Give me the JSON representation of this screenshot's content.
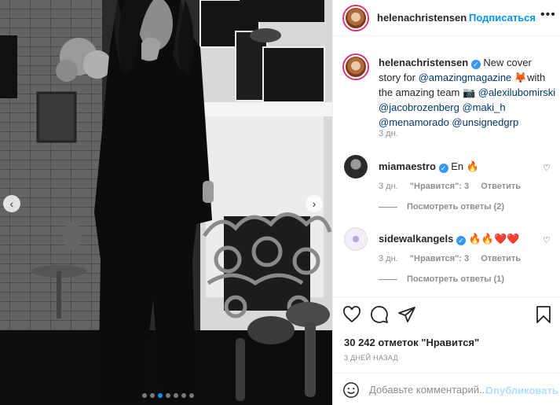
{
  "post": {
    "photo_alt": "",
    "carousel": {
      "count": 7,
      "active_index": 2
    }
  },
  "header": {
    "username": "helenachristensen",
    "follow_label": "Подписаться",
    "more_label": "•••"
  },
  "caption": {
    "username": "helenachristensen",
    "verified_mark": "✓",
    "text_1": " New cover story for ",
    "mention_1": "@amazingmagazine",
    "text_2": " 🦊with the amazing team 📷 ",
    "mention_2": "@alexilubomirski",
    "mention_3": "@jacobrozenberg",
    "mention_4": "@maki_h",
    "mention_5": "@menamorado",
    "mention_6": "@unsignedgrp",
    "time": "3 дн."
  },
  "comments": [
    {
      "username": "miamaestro",
      "verified_mark": "✓",
      "text": " En 🔥",
      "time": "3 дн.",
      "likes": "\"Нравится\": 3",
      "reply": "Ответить",
      "view_replies": "Посмотреть ответы (2)"
    },
    {
      "username": "sidewalkangels",
      "verified_mark": "✓",
      "text": " 🔥🔥❤️❤️",
      "time": "3 дн.",
      "likes": "\"Нравится\": 3",
      "reply": "Ответить",
      "view_replies": "Посмотреть ответы (1)"
    }
  ],
  "likes_text": "30 242 отметок \"Нравится\"",
  "post_time": "3 дней назад",
  "add_comment": {
    "placeholder": "Добавьте комментарий...",
    "publish_label": "Опубликовать"
  },
  "icons": {
    "like": "heart-icon",
    "comment": "comment-icon",
    "share": "share-icon",
    "save": "bookmark-icon",
    "emoji": "smile-icon"
  },
  "colors": {
    "accent": "#0095f6",
    "link": "#00376b",
    "muted": "#8e8e8e",
    "publish_disabled": "#b2dffc"
  }
}
